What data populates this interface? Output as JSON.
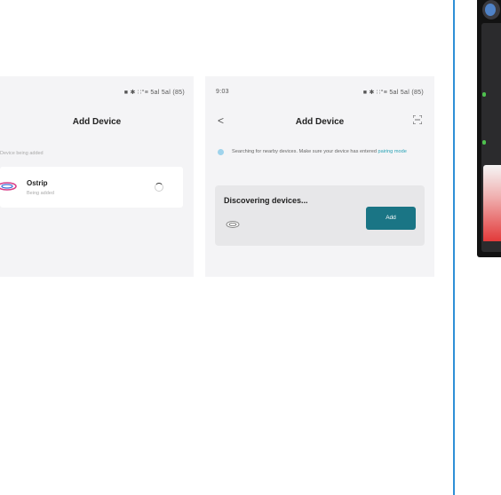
{
  "screen_left": {
    "status": "■ ✱ ∷°≡ 5al 5al (85)",
    "title": "Add Device",
    "hint": "Device being added",
    "device": {
      "name": "Ostrip",
      "status": "Being added"
    }
  },
  "screen_right": {
    "status_time": "9:03",
    "status": "■ ✱ ∷°≡ 5al 5al (85)",
    "title": "Add Device",
    "back": "<",
    "notice_text": "Searching for nearby devices. Make sure your device has entered ",
    "notice_link": "pairing mode",
    "card_title": "Discovering devices...",
    "add_label": "Add",
    "bottom_text": "· · · · ·"
  },
  "icons": [
    "scan-icon",
    "device-icon",
    "spinner-icon",
    "info-icon"
  ],
  "colors": {
    "accent": "#1a7585",
    "link": "#2aa3b6",
    "divider": "#2e8fd6"
  }
}
